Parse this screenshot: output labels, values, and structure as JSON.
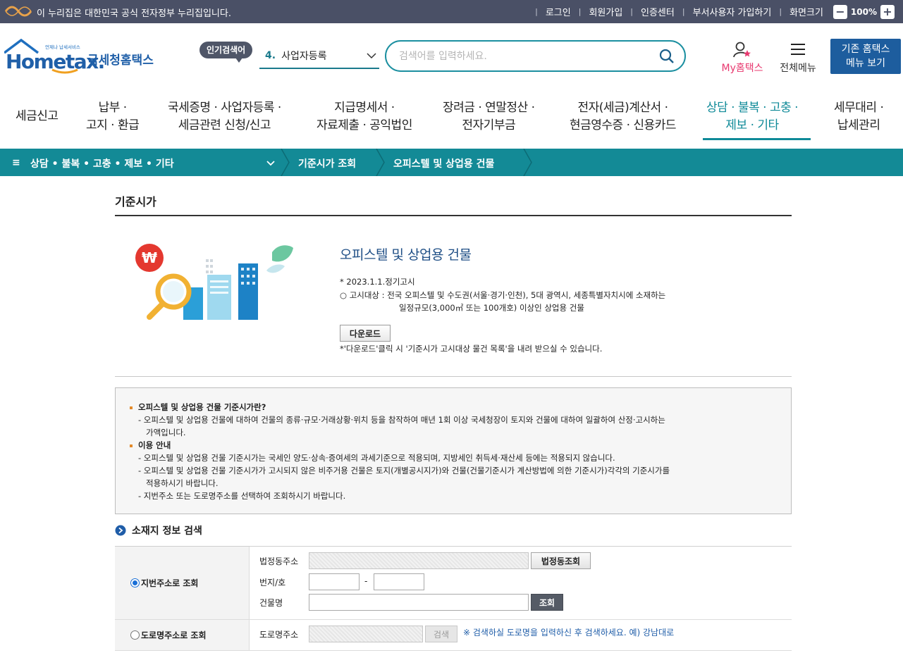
{
  "gov_bar": {
    "notice": "이 누리집은 대한민국 공식 전자정부 누리집입니다.",
    "links": [
      "로그인",
      "회원가입",
      "인증센터",
      "부서사용자 가입하기",
      "화면크기"
    ],
    "zoom_minus": "−",
    "zoom_value": "100%",
    "zoom_plus": "+"
  },
  "header": {
    "logo_main": "Hometax.",
    "logo_sub": "국세청홈택스",
    "logo_small": "언제나 납세서비스",
    "popular_label": "인기검색어",
    "popular_num": "4.",
    "popular_term": "사업자등록",
    "search_placeholder": "검색어를 입력하세요.",
    "my_hometax": "My홈택스",
    "all_menu": "전체메뉴",
    "legacy_line1": "기존 홈택스",
    "legacy_line2": "메뉴 보기"
  },
  "gnb": [
    {
      "l1": "세금신고",
      "l2": ""
    },
    {
      "l1": "납부 ·",
      "l2": "고지 · 환급"
    },
    {
      "l1": "국세증명 · 사업자등록 ·",
      "l2": "세금관련 신청/신고"
    },
    {
      "l1": "지급명세서 ·",
      "l2": "자료제출 · 공익법인"
    },
    {
      "l1": "장려금 · 연말정산 ·",
      "l2": "전자기부금"
    },
    {
      "l1": "전자(세금)계산서 ·",
      "l2": "현금영수증 · 신용카드"
    },
    {
      "l1": "상담 · 불복 · 고충 ·",
      "l2": "제보 · 기타"
    },
    {
      "l1": "세무대리 ·",
      "l2": "납세관리"
    }
  ],
  "breadcrumb": {
    "hamburger": "≡",
    "level1": "상담 • 불복 • 고충 • 제보 • 기타",
    "level2": "기준시가 조회",
    "level3": "오피스텔 및 상업용 건물"
  },
  "content": {
    "page_title": "기준시가",
    "hero_title": "오피스텔 및 상업용 건물",
    "notice_date": "* 2023.1.1.정기고시",
    "notice_target_1": "○ 고시대상 : 전국 오피스텔 및 수도권(서울·경기·인천), 5대 광역시, 세종특별자치시에 소재하는",
    "notice_target_2": "일정규모(3,000㎡ 또는 100개호) 이상인 상업용 건물",
    "download_label": "다운로드",
    "download_note": "*'다운로드'클릭 시 '기준시가 고시대상 물건 목록'을 내려 받으실 수 있습니다.",
    "info": {
      "h1": "오피스텔 및 상업용 건물 기준시가란?",
      "p1a": "- 오피스텔 및 상업용 건물에 대하여 건물의 종류·규모·거래상황·위치 등을 참작하여 매년 1회 이상 국세청장이 토지와 건물에 대하여 일괄하여 산정·고시하는",
      "p1b": "가액입니다.",
      "h2": "이용 안내",
      "p2": "- 오피스텔 및 상업용 건물 기준시가는 국세인 양도·상속·증여세의 과세기준으로 적용되며, 지방세인 취득세·재산세 등에는 적용되지 않습니다.",
      "p3a": "- 오피스텔 및 상업용 건물 기준시가가 고시되지 않은 비주거용 건물은 토지(개별공시지가)와 건물(건물기준시가 계산방법에 의한 기준시가)각각의 기준시가를",
      "p3b": "적용하시기 바랍니다.",
      "p4": "- 지번주소 또는 도로명주소를 선택하여 조회하시기 바랍니다."
    },
    "section_title": "소재지 정보 검색",
    "search": {
      "jibun_label": "지번주소로 조회",
      "legal_dong_label": "법정동주소",
      "legal_dong_btn": "법정동조회",
      "bunji_label": "번지/호",
      "bunji_dash": "-",
      "building_label": "건물명",
      "query_btn": "조회",
      "road_label": "도로명주소로 조회",
      "road_field_label": "도로명주소",
      "road_search_btn": "검색",
      "road_note": "※ 검색하실 도로명을 입력하신 후 검색하세요. 예) 강남대로"
    }
  },
  "colors": {
    "gov_bar": "#4a5066",
    "teal": "#138a96",
    "navy": "#1d5d9e",
    "pink": "#e8386f"
  }
}
